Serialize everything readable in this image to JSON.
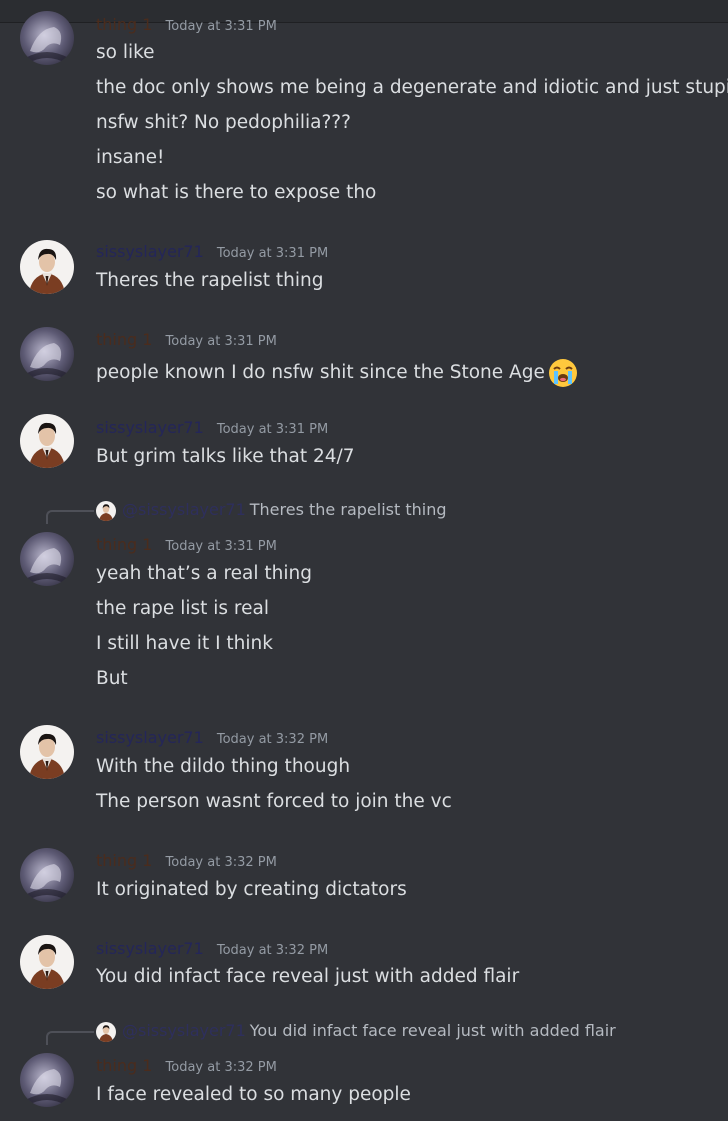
{
  "colors": {
    "background": "#313338",
    "username_thing1": "#4a2c1d",
    "username_sissy": "#242659",
    "timestamp": "#949ba4",
    "text": "#dbdee1"
  },
  "top_partial": {
    "username": "thing 1",
    "timestamp": "Today at 3:31 PM",
    "lines": [
      "so like",
      "the doc only shows me being a degenerate and idiotic and just stupid?",
      "nsfw shit? No pedophilia???",
      "insane!",
      "so what is there to expose tho"
    ]
  },
  "messages": [
    {
      "username": "sissyslayer71",
      "timestamp": "Today at 3:31 PM",
      "lines": [
        "Theres the rapelist thing"
      ]
    },
    {
      "username": "thing 1",
      "timestamp": "Today at 3:31 PM",
      "lines": [
        "people known I do nsfw shit since the Stone Age"
      ],
      "emoji": "loudly-crying-face"
    },
    {
      "username": "sissyslayer71",
      "timestamp": "Today at 3:31 PM",
      "lines": [
        "But grim talks like that 24/7"
      ]
    },
    {
      "reply_to": {
        "username": "@sissyslayer71",
        "text": "Theres the rapelist thing"
      },
      "username": "thing 1",
      "timestamp": "Today at 3:31 PM",
      "lines": [
        "yeah that’s a real thing",
        "the rape list is real",
        "I still have it I think",
        "But"
      ]
    },
    {
      "username": "sissyslayer71",
      "timestamp": "Today at 3:32 PM",
      "lines": [
        "With the dildo thing though",
        "The person wasnt forced to join the vc"
      ]
    },
    {
      "username": "thing 1",
      "timestamp": "Today at 3:32 PM",
      "lines": [
        "It originated by creating dictators"
      ]
    },
    {
      "username": "sissyslayer71",
      "timestamp": "Today at 3:32 PM",
      "lines": [
        "You did infact face reveal just with added flair"
      ]
    },
    {
      "reply_to": {
        "username": "@sissyslayer71",
        "text": "You did infact face reveal just with added flair"
      },
      "username": "thing 1",
      "timestamp": "Today at 3:32 PM",
      "lines": [
        "I face revealed to so many people"
      ]
    }
  ]
}
